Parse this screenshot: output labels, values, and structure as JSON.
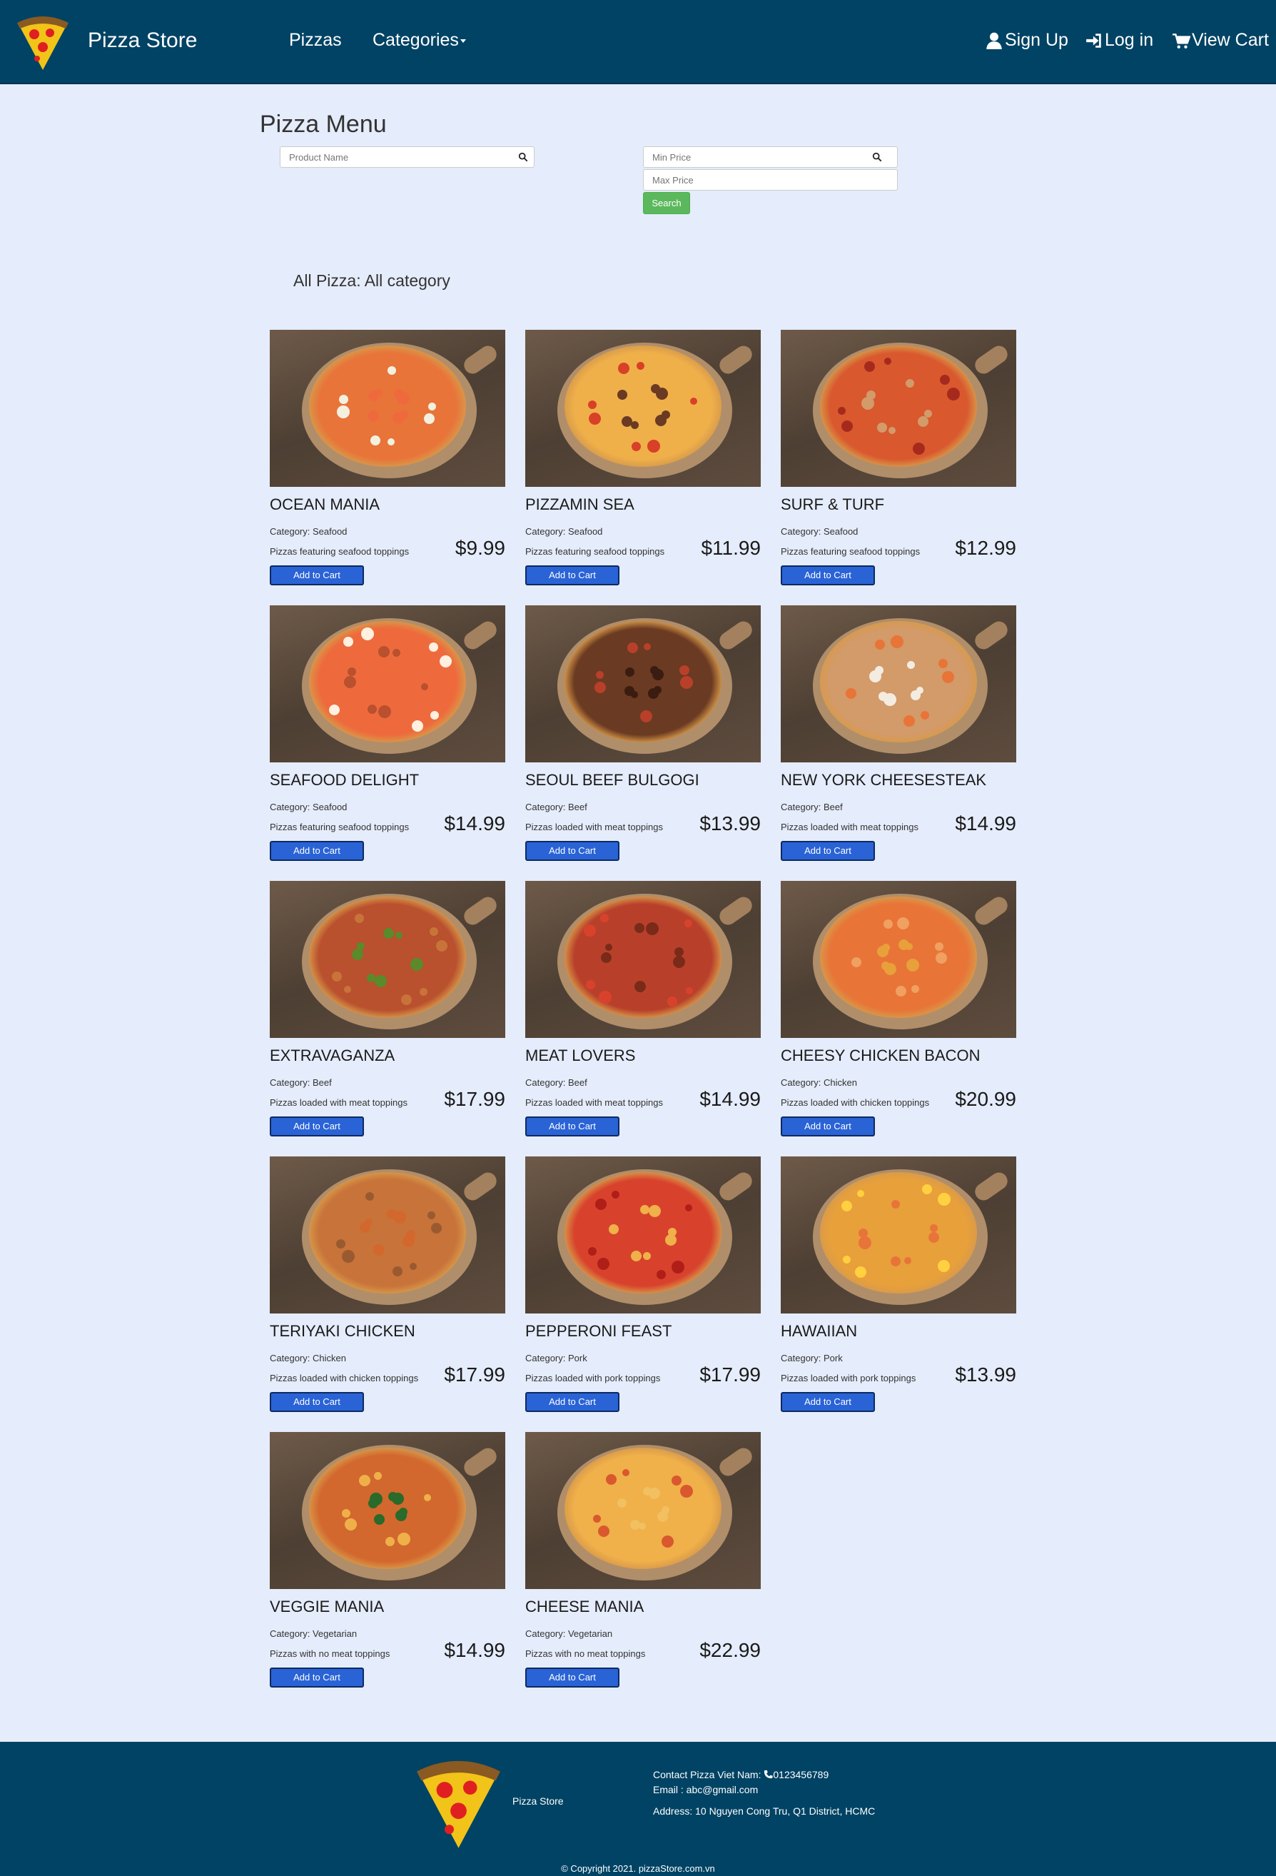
{
  "colors": {
    "navbar": "#004364",
    "background": "#e5ecfb",
    "search_button": "#5cb85c",
    "cart_button": "#2a63d6"
  },
  "navbar": {
    "brand": "Pizza Store",
    "brand_icon": "pizza-slice-icon",
    "links": {
      "pizzas": "Pizzas",
      "categories": "Categories"
    },
    "signup": "Sign Up",
    "login": "Log in",
    "cart": "View Cart"
  },
  "search": {
    "title": "Pizza Menu",
    "name_placeholder": "Product Name",
    "min_placeholder": "Min Price",
    "max_placeholder": "Max Price",
    "button": "Search"
  },
  "section_heading": "All Pizza: All category",
  "products": [
    {
      "name": "OCEAN MANIA",
      "category": "Category: Seafood",
      "desc": "Pizzas featuring seafood toppings",
      "price": "$9.99",
      "button": "Add to Cart"
    },
    {
      "name": "PIZZAMIN SEA",
      "category": "Category: Seafood",
      "desc": "Pizzas featuring seafood toppings",
      "price": "$11.99",
      "button": "Add to Cart"
    },
    {
      "name": "SURF & TURF",
      "category": "Category: Seafood",
      "desc": "Pizzas featuring seafood toppings",
      "price": "$12.99",
      "button": "Add to Cart"
    },
    {
      "name": "SEAFOOD DELIGHT",
      "category": "Category: Seafood",
      "desc": "Pizzas featuring seafood toppings",
      "price": "$14.99",
      "button": "Add to Cart"
    },
    {
      "name": "SEOUL BEEF BULGOGI",
      "category": "Category: Beef",
      "desc": "Pizzas loaded with meat toppings",
      "price": "$13.99",
      "button": "Add to Cart"
    },
    {
      "name": "NEW YORK CHEESESTEAK",
      "category": "Category: Beef",
      "desc": "Pizzas loaded with meat toppings",
      "price": "$14.99",
      "button": "Add to Cart"
    },
    {
      "name": "EXTRAVAGANZA",
      "category": "Category: Beef",
      "desc": "Pizzas loaded with meat toppings",
      "price": "$17.99",
      "button": "Add to Cart"
    },
    {
      "name": "MEAT LOVERS",
      "category": "Category: Beef",
      "desc": "Pizzas loaded with meat toppings",
      "price": "$14.99",
      "button": "Add to Cart"
    },
    {
      "name": "CHEESY CHICKEN BACON",
      "category": "Category: Chicken",
      "desc": "Pizzas loaded with chicken toppings",
      "price": "$20.99",
      "button": "Add to Cart"
    },
    {
      "name": "TERIYAKI CHICKEN",
      "category": "Category: Chicken",
      "desc": "Pizzas loaded with chicken toppings",
      "price": "$17.99",
      "button": "Add to Cart"
    },
    {
      "name": "PEPPERONI FEAST",
      "category": "Category: Pork",
      "desc": "Pizzas loaded with pork toppings",
      "price": "$17.99",
      "button": "Add to Cart"
    },
    {
      "name": "HAWAIIAN",
      "category": "Category: Pork",
      "desc": "Pizzas loaded with pork toppings",
      "price": "$13.99",
      "button": "Add to Cart"
    },
    {
      "name": "VEGGIE MANIA",
      "category": "Category: Vegetarian",
      "desc": "Pizzas with no meat toppings",
      "price": "$14.99",
      "button": "Add to Cart"
    },
    {
      "name": "CHEESE MANIA",
      "category": "Category: Vegetarian",
      "desc": "Pizzas with no meat toppings",
      "price": "$22.99",
      "button": "Add to Cart"
    }
  ],
  "footer": {
    "brand": "Pizza Store",
    "contact": "Contact Pizza Viet Nam: ",
    "phone": "0123456789",
    "email": "Email : abc@gmail.com",
    "address": "Address: 10 Nguyen Cong Tru, Q1 District, HCMC",
    "copyright": "© Copyright 2021. pizzaStore.com.vn"
  }
}
